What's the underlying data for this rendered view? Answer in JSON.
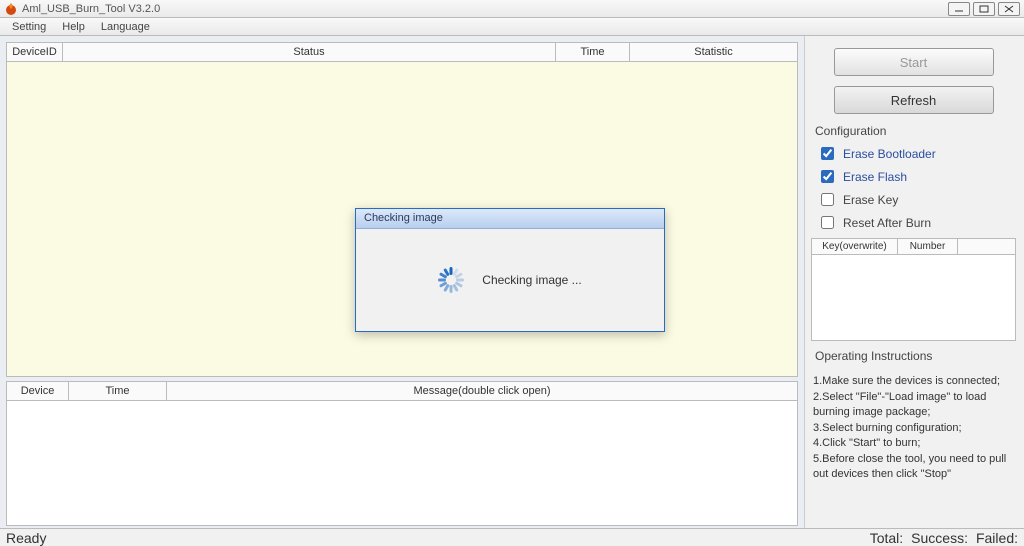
{
  "window": {
    "title": "Aml_USB_Burn_Tool V3.2.0"
  },
  "menu": {
    "items": [
      "Setting",
      "Help",
      "Language"
    ]
  },
  "top_table": {
    "headers": [
      "DeviceID",
      "Status",
      "Time",
      "Statistic"
    ]
  },
  "lower_table": {
    "headers": [
      "Device",
      "Time",
      "Message(double click open)"
    ]
  },
  "buttons": {
    "start": "Start",
    "refresh": "Refresh"
  },
  "config": {
    "title": "Configuration",
    "erase_bootloader": {
      "label": "Erase Bootloader",
      "checked": true
    },
    "erase_flash": {
      "label": "Erase Flash",
      "checked": true
    },
    "erase_key": {
      "label": "Erase Key",
      "checked": false
    },
    "reset_after_burn": {
      "label": "Reset After Burn",
      "checked": false
    }
  },
  "key_table": {
    "headers": [
      "Key(overwrite)",
      "Number",
      ""
    ]
  },
  "instructions": {
    "title": "Operating Instructions",
    "lines": [
      "1.Make sure the devices is connected;",
      "2.Select \"File\"-\"Load image\" to load burning image package;",
      "3.Select burning configuration;",
      "4.Click \"Start\" to burn;",
      "5.Before close the tool, you need to pull out devices then click \"Stop\""
    ]
  },
  "dialog": {
    "title": "Checking image",
    "message": "Checking image ..."
  },
  "status": {
    "ready": "Ready",
    "total_label": "Total:",
    "success_label": "Success:",
    "failed_label": "Failed:"
  }
}
